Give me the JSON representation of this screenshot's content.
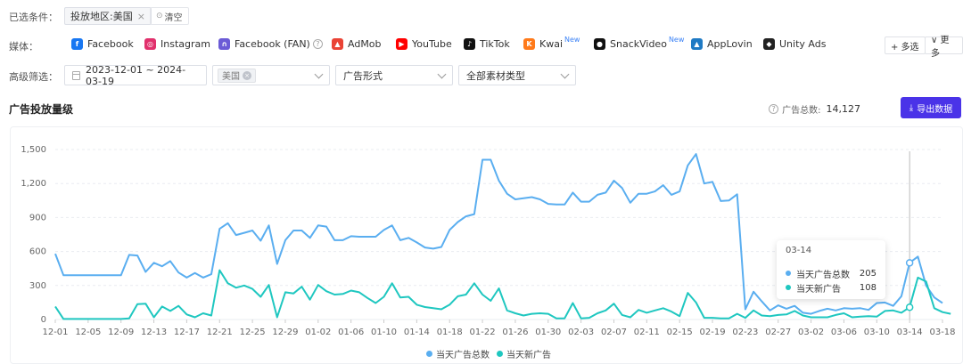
{
  "filters_selected": {
    "label": "已选条件：",
    "chip": "投放地区:美国",
    "chip_close": "×",
    "clear_icon": "⊙",
    "clear": "清空"
  },
  "media": {
    "label": "媒体：",
    "items": [
      {
        "name": "Facebook",
        "color": "#1877f2",
        "glyph": "f",
        "new": ""
      },
      {
        "name": "Instagram",
        "color": "#e1306c",
        "glyph": "◎",
        "new": ""
      },
      {
        "name": "Facebook (FAN)",
        "color": "#6b5bd6",
        "glyph": "∩",
        "new": ""
      },
      {
        "name": "AdMob",
        "color": "#ea4335",
        "glyph": "▲",
        "new": ""
      },
      {
        "name": "YouTube",
        "color": "#ff0000",
        "glyph": "▶",
        "new": ""
      },
      {
        "name": "TikTok",
        "color": "#111111",
        "glyph": "♪",
        "new": ""
      },
      {
        "name": "Kwai",
        "color": "#ff7a1a",
        "glyph": "K",
        "new": "New"
      },
      {
        "name": "SnackVideo",
        "color": "#111111",
        "glyph": "●",
        "new": "New"
      },
      {
        "name": "AppLovin",
        "color": "#1f7ac4",
        "glyph": "▲",
        "new": ""
      },
      {
        "name": "Unity Ads",
        "color": "#222222",
        "glyph": "◆",
        "new": ""
      }
    ],
    "multi_select": "+ 多选",
    "more": "∨ 更多"
  },
  "advanced": {
    "label": "高级筛选：",
    "date_range": "2023-12-01 ~ 2024-03-19",
    "region_tag": "美国",
    "ad_format": "广告形式",
    "material_type": "全部素材类型"
  },
  "section": {
    "title": "广告投放量级",
    "total_label": "广告总数:",
    "total_value": "14,127",
    "export": "导出数据"
  },
  "tooltip": {
    "date": "03-14",
    "rows": [
      {
        "name": "当天广告总数",
        "value": "205"
      },
      {
        "name": "当天新广告",
        "value": "108"
      }
    ]
  },
  "colors": {
    "series_total": "#5aaef0",
    "series_new": "#1fc7c0",
    "accent": "#4a33e8"
  },
  "chart_data": {
    "type": "line",
    "title": "",
    "ylim": [
      0,
      1500
    ],
    "yticks": [
      "0",
      "300",
      "600",
      "900",
      "1,200",
      "1,500"
    ],
    "ytick_values": [
      0,
      300,
      600,
      900,
      1200,
      1500
    ],
    "x_tick_labels": [
      "12-01",
      "12-05",
      "12-09",
      "12-13",
      "12-17",
      "12-21",
      "12-25",
      "12-29",
      "01-02",
      "01-06",
      "01-10",
      "01-14",
      "01-18",
      "01-22",
      "01-26",
      "01-30",
      "02-03",
      "02-07",
      "02-11",
      "02-15",
      "02-19",
      "02-23",
      "02-27",
      "03-02",
      "03-06",
      "03-10",
      "03-14",
      "03-18"
    ],
    "x_start": "12-01",
    "x_end": "03-19",
    "legend_position": "bottom",
    "series": [
      {
        "name": "当天广告总数",
        "values": [
          580,
          390,
          390,
          390,
          390,
          390,
          390,
          390,
          390,
          570,
          565,
          420,
          500,
          470,
          515,
          415,
          370,
          410,
          370,
          400,
          800,
          850,
          745,
          765,
          785,
          695,
          830,
          490,
          700,
          785,
          785,
          720,
          830,
          820,
          700,
          700,
          735,
          730,
          730,
          730,
          790,
          830,
          700,
          720,
          680,
          635,
          625,
          640,
          790,
          860,
          910,
          930,
          1410,
          1410,
          1225,
          1110,
          1060,
          1070,
          1080,
          1060,
          1020,
          1015,
          1015,
          1120,
          1040,
          1040,
          1100,
          1120,
          1225,
          1160,
          1030,
          1110,
          1110,
          1130,
          1185,
          1100,
          1130,
          1360,
          1460,
          1200,
          1215,
          1045,
          1050,
          1105,
          90,
          245,
          160,
          80,
          125,
          95,
          120,
          60,
          50,
          75,
          95,
          80,
          100,
          95,
          100,
          85,
          145,
          150,
          120,
          205,
          500,
          555,
          300,
          195,
          145
        ]
      },
      {
        "name": "当天新广告",
        "values": [
          115,
          5,
          5,
          5,
          5,
          5,
          5,
          5,
          5,
          10,
          135,
          140,
          20,
          115,
          75,
          120,
          45,
          20,
          55,
          35,
          435,
          320,
          280,
          300,
          270,
          200,
          305,
          20,
          240,
          230,
          290,
          175,
          305,
          250,
          220,
          225,
          255,
          240,
          190,
          145,
          200,
          320,
          195,
          200,
          130,
          110,
          100,
          90,
          130,
          205,
          220,
          320,
          220,
          165,
          275,
          80,
          55,
          35,
          50,
          55,
          50,
          10,
          10,
          145,
          10,
          15,
          55,
          80,
          140,
          40,
          20,
          85,
          60,
          80,
          100,
          70,
          30,
          235,
          150,
          15,
          15,
          10,
          10,
          50,
          15,
          80,
          35,
          30,
          40,
          45,
          75,
          35,
          20,
          20,
          20,
          40,
          55,
          20,
          25,
          30,
          25,
          75,
          80,
          60,
          108,
          370,
          335,
          100,
          65,
          50
        ]
      }
    ]
  }
}
